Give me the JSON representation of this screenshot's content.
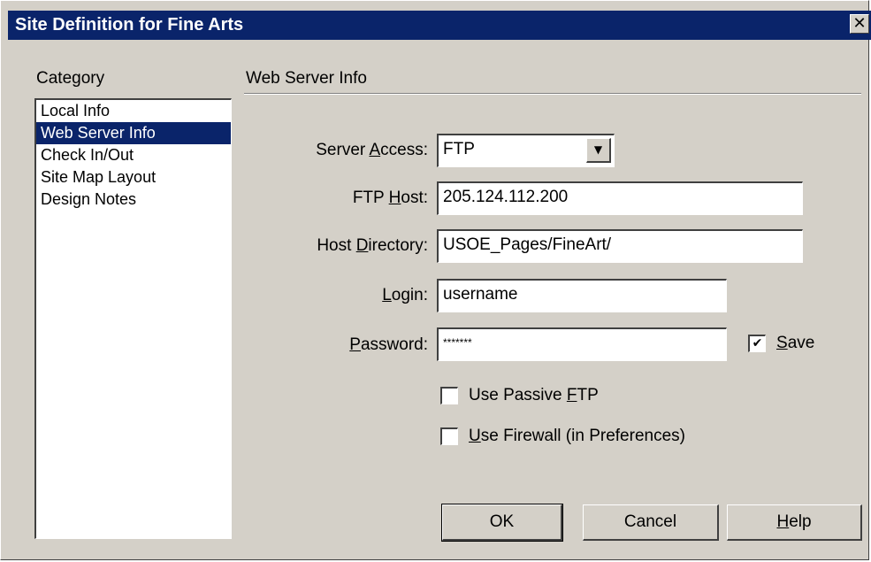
{
  "window": {
    "title": "Site Definition for Fine Arts",
    "close_glyph": "✕"
  },
  "category": {
    "heading": "Category",
    "items": [
      {
        "label": "Local Info",
        "selected": false
      },
      {
        "label": "Web Server Info",
        "selected": true
      },
      {
        "label": "Check In/Out",
        "selected": false
      },
      {
        "label": "Site Map Layout",
        "selected": false
      },
      {
        "label": "Design Notes",
        "selected": false
      }
    ]
  },
  "panel": {
    "heading": "Web Server Info",
    "server_access": {
      "label_pre": "Server ",
      "label_key": "A",
      "label_post": "ccess:",
      "value": "FTP"
    },
    "ftp_host": {
      "label_pre": "FTP ",
      "label_key": "H",
      "label_post": "ost:",
      "value": "205.124.112.200"
    },
    "host_directory": {
      "label_pre": "Host ",
      "label_key": "D",
      "label_post": "irectory:",
      "value": "USOE_Pages/FineArt/"
    },
    "login": {
      "label_pre": "",
      "label_key": "L",
      "label_post": "ogin:",
      "value": "username"
    },
    "password": {
      "label_pre": "",
      "label_key": "P",
      "label_post": "assword:",
      "value": "*******"
    },
    "save": {
      "label_pre": "",
      "label_key": "S",
      "label_post": "ave",
      "checked": true
    },
    "passive_ftp": {
      "label_pre": "Use Passive ",
      "label_key": "F",
      "label_post": "TP",
      "checked": false
    },
    "firewall": {
      "label_pre": "",
      "label_key": "U",
      "label_post": "se Firewall (in Preferences)",
      "checked": false
    },
    "check_glyph": "✔"
  },
  "buttons": {
    "ok": "OK",
    "cancel": "Cancel",
    "help_key": "H",
    "help_post": "elp"
  },
  "colors": {
    "titlebar": "#0a246a",
    "face": "#d4d0c8",
    "selection": "#0a246a"
  },
  "icons": {
    "close": "close-icon",
    "dropdown": "chevron-down-icon",
    "check": "checkmark-icon"
  }
}
